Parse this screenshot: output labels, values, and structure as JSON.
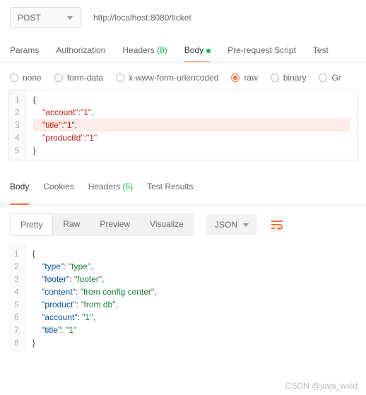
{
  "request": {
    "method": "POST",
    "url": "http://localhost:8080/ticket"
  },
  "tabs": {
    "params": "Params",
    "authorization": "Authorization",
    "headers_label": "Headers",
    "headers_count": "(8)",
    "body": "Body",
    "prerequest": "Pre-request Script",
    "tests": "Test"
  },
  "body_types": {
    "none": "none",
    "formdata": "form-data",
    "urlencoded": "x-www-form-urlencoded",
    "raw": "raw",
    "binary": "binary",
    "graphql": "Gr"
  },
  "req_body_lines": [
    {
      "n": "1",
      "html": "<span class='b'>{</span>"
    },
    {
      "n": "2",
      "html": "    <span class='k'>\"account\"</span>:<span class='k'>\"1\"</span>,"
    },
    {
      "n": "3",
      "html": "    <span class='k'>\"title\"</span>:<span class='k'>\"1\"</span>,",
      "hl": true
    },
    {
      "n": "4",
      "html": "    <span class='k'>\"productId\"</span>:<span class='k'>\"1\"</span>"
    },
    {
      "n": "5",
      "html": "<span class='b'>}</span>"
    }
  ],
  "res_tabs": {
    "body": "Body",
    "cookies": "Cookies",
    "headers_label": "Headers",
    "headers_count": "(5)",
    "testresults": "Test Results"
  },
  "view_modes": {
    "pretty": "Pretty",
    "raw": "Raw",
    "preview": "Preview",
    "visualize": "Visualize",
    "json": "JSON"
  },
  "res_body_lines": [
    {
      "n": "1",
      "html": "<span class='b'>{</span>"
    },
    {
      "n": "2",
      "html": "    <span class='sb'>\"type\"</span>: <span class='s'>\"type\"</span>,"
    },
    {
      "n": "3",
      "html": "    <span class='sb'>\"footer\"</span>: <span class='s'>\"footer\"</span>,"
    },
    {
      "n": "4",
      "html": "    <span class='sb'>\"content\"</span>: <span class='s'>\"from config center\"</span>,"
    },
    {
      "n": "5",
      "html": "    <span class='sb'>\"product\"</span>: <span class='s'>\"from db\"</span>,"
    },
    {
      "n": "6",
      "html": "    <span class='sb'>\"account\"</span>: <span class='s'>\"1\"</span>,"
    },
    {
      "n": "7",
      "html": "    <span class='sb'>\"title\"</span>: <span class='s'>\"1\"</span>"
    },
    {
      "n": "8",
      "html": "<span class='b'>}</span>"
    }
  ],
  "watermark": "CSDN @java_wxid"
}
